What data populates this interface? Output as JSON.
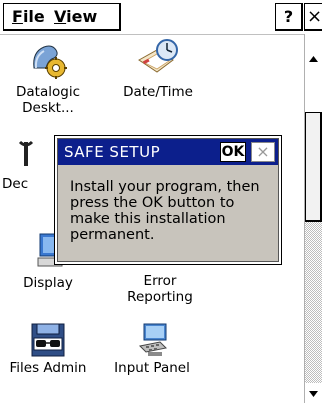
{
  "menubar": {
    "file_first": "F",
    "file_rest": "ile",
    "view_first": "V",
    "view_rest": "iew",
    "help_label": "?",
    "close_label": "×"
  },
  "desktop": {
    "icons": [
      {
        "label": "Datalogic\nDeskt...",
        "icon": "datalogic-desktop-icon"
      },
      {
        "label": "Date/Time",
        "icon": "date-time-icon"
      },
      {
        "label": "Dec",
        "icon": "device-properties-icon"
      },
      {
        "label": "Display",
        "icon": "display-icon"
      },
      {
        "label": "Error\nReporting",
        "icon": "error-reporting-icon"
      },
      {
        "label": "Files Admin",
        "icon": "files-admin-icon"
      },
      {
        "label": "Input Panel",
        "icon": "input-panel-icon"
      }
    ]
  },
  "dialog": {
    "title": "SAFE SETUP",
    "ok_label": "OK",
    "close_label": "×",
    "message": "Install your program, then press the OK button to make this installation permanent."
  },
  "colors": {
    "dialog_titlebar": "#0c1f8c",
    "dialog_body": "#c8c4bc"
  }
}
